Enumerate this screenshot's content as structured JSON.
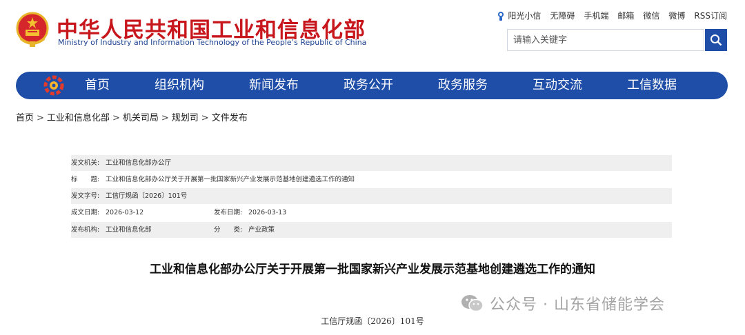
{
  "header": {
    "cn_name": "中华人民共和国工业和信息化部",
    "en_name": "Ministry of Industry and Information Technology of the People’s Republic of China"
  },
  "toplinks": [
    "阳光小信",
    "无障碍",
    "手机端",
    "邮箱",
    "微信",
    "微博",
    "RSS订阅"
  ],
  "search": {
    "placeholder": "请输入关键字"
  },
  "nav": [
    "首页",
    "组织机构",
    "新闻发布",
    "政务公开",
    "政务服务",
    "互动交流",
    "工信数据"
  ],
  "breadcrumb": [
    "首页",
    "工业和信息化部",
    "机关司局",
    "规划司",
    "文件发布"
  ],
  "meta": {
    "issuer_label": "发文机关:",
    "issuer": "工业和信息化部办公厅",
    "title_label": "标　　题:",
    "title": "工业和信息化部办公厅关于开展第一批国家新兴产业发展示范基地创建遴选工作的通知",
    "docno_label": "发文字号:",
    "docno": "工信厅规函〔2026〕101号",
    "created_label": "成文日期:",
    "created": "2026-03-12",
    "published_label": "发布日期:",
    "published": "2026-03-13",
    "org_label": "发布机构:",
    "org": "工业和信息化部",
    "category_label": "分　　类:",
    "category": "产业政策"
  },
  "doc": {
    "title": "工业和信息化部办公厅关于开展第一批国家新兴产业发展示范基地创建遴选工作的通知",
    "number": "工信厅规函〔2026〕101号"
  },
  "watermark": "公众号 · 山东省储能学会",
  "colors": {
    "brand_red": "#c8161d",
    "nav_blue": "#1f4ea8"
  }
}
